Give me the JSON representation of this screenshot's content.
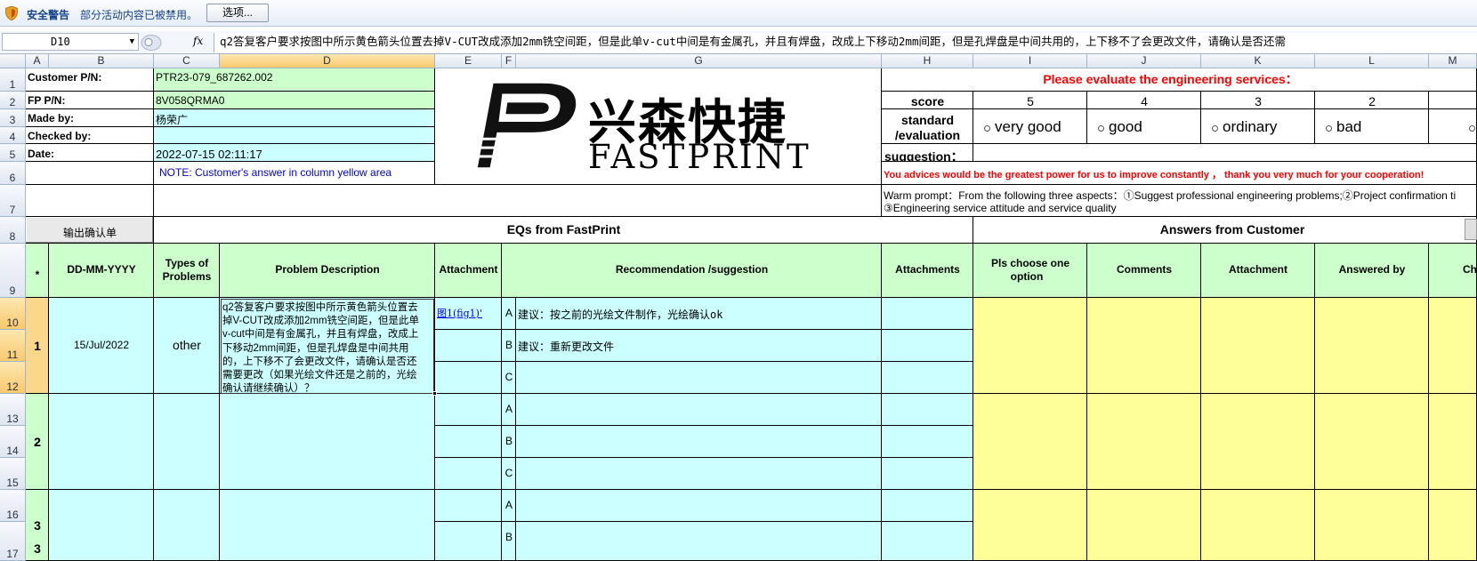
{
  "security_bar": {
    "title": "安全警告",
    "message": "部分活动内容已被禁用。",
    "options_button": "选项..."
  },
  "formula_bar": {
    "name_box": "D10",
    "fx_label": "fx",
    "formula": "q2答复客户要求按图中所示黄色箭头位置去掉V-CUT改成添加2mm铣空间距，但是此单v-cut中间是有金属孔，并且有焊盘，改成上下移动2mm间距，但是孔焊盘是中间共用的，上下移不了会更改文件，请确认是否还需"
  },
  "columns": [
    "A",
    "B",
    "C",
    "D",
    "E",
    "F",
    "G",
    "H",
    "I",
    "J",
    "K",
    "L",
    "M"
  ],
  "rows": [
    "1",
    "2",
    "3",
    "4",
    "5",
    "6",
    "7",
    "8",
    "9",
    "10",
    "11",
    "12",
    "13",
    "14",
    "15",
    "16",
    "17"
  ],
  "header": {
    "customer_pn_label": "Customer P/N:",
    "customer_pn_value": "PTR23-079_687262.002",
    "fp_pn_label": "FP P/N:",
    "fp_pn_value": "8V058QRMA0",
    "made_by_label": "Made by:",
    "made_by_value": "杨荣广",
    "checked_by_label": "Checked by:",
    "checked_by_value": "",
    "date_label": "Date:",
    "date_value": "2022-07-15 02:11:17",
    "note": "NOTE: Customer's  answer in column yellow area"
  },
  "logo": {
    "chinese": "兴森快捷",
    "english": "FASTPRINT"
  },
  "evaluation": {
    "title": "Please evaluate the engineering services：",
    "score_label": "score",
    "scores": [
      "5",
      "4",
      "3",
      "2"
    ],
    "standard_label_1": "standard",
    "standard_label_2": "/evaluation",
    "options": [
      "very good",
      "good",
      "ordinary",
      "bad"
    ],
    "suggestion_label": "suggestion：",
    "advice": "You advices would be the greatest power for us to improve constantly ，  thank you very much for your cooperation!",
    "warm_prompt_1": "Warm prompt：From the following three aspects：①Suggest professional engineering problems;②Project confirmation ti",
    "warm_prompt_2": "③Engineering service attitude and service quality"
  },
  "section": {
    "export_button": "输出确认单",
    "eqs_title": "EQs from FastPrint",
    "answers_title": "Answers from Customer"
  },
  "table_headers": {
    "star": "*",
    "date": "DD-MM-YYYY",
    "types_1": "Types of",
    "types_2": "Problems",
    "problem": "Problem Description",
    "attachment": "Attachment",
    "recommendation": "Recommendation /suggestion",
    "attachments": "Attachments",
    "choose_1": "Pls choose one",
    "choose_2": "option",
    "comments": "Comments",
    "cust_attachment": "Attachment",
    "answered_by": "Answered by",
    "checked": "Chec"
  },
  "eq1": {
    "number": "1",
    "date": "15/Jul/2022",
    "type": "other",
    "description_lines": [
      "q2答复客户要求按图中所示黄色箭头位置去",
      "掉V-CUT改成添加2mm铣空间距，但是此单",
      "v-cut中间是有金属孔，并且有焊盘，改成上",
      "下移动2mm间距，但是孔焊盘是中间共用",
      "的，上下移不了会更改文件，请确认是否还",
      "需要更改（如果光绘文件还是之前的，光绘",
      "确认请继续确认）？"
    ],
    "attachment_link": "图1(fig1)'",
    "options": [
      {
        "letter": "A",
        "text": "建议：按之前的光绘文件制作，光绘确认ok"
      },
      {
        "letter": "B",
        "text": "建议：重新更改文件"
      },
      {
        "letter": "C",
        "text": ""
      }
    ]
  },
  "eq2": {
    "number": "2",
    "letters": [
      "A",
      "B",
      "C"
    ]
  },
  "eq3": {
    "number": "3",
    "letters": [
      "A",
      "B"
    ]
  },
  "colors": {
    "cyan": "#ccffff",
    "green": "#ccffcc",
    "yellow": "#ffff99",
    "row_selected": "#fbd78b",
    "red_text": "#ff0000",
    "note_blue": "#0000cc"
  }
}
